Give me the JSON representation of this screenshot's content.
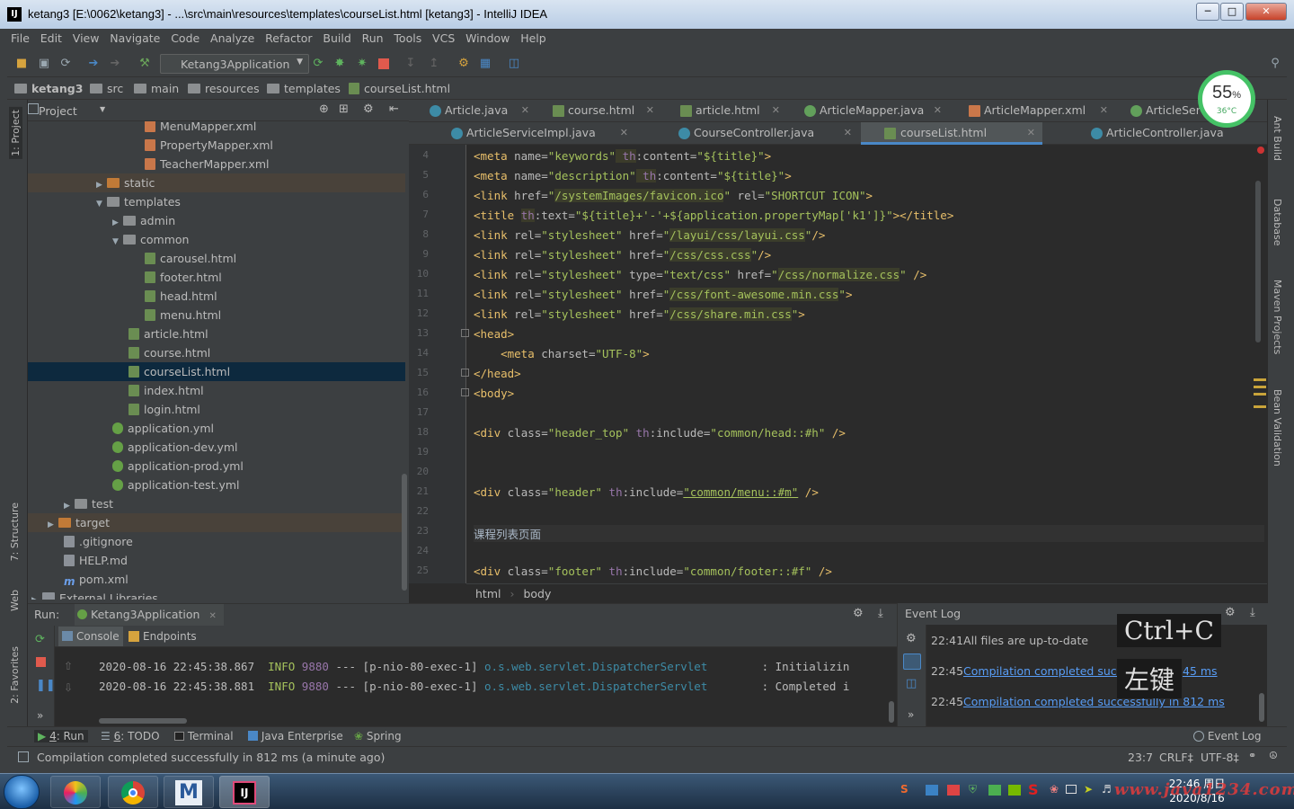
{
  "window": {
    "title": "ketang3 [E:\\0062\\ketang3] - ...\\src\\main\\resources\\templates\\courseList.html [ketang3] - IntelliJ IDEA",
    "ij_icon": "IJ"
  },
  "menu": [
    "File",
    "Edit",
    "View",
    "Navigate",
    "Code",
    "Analyze",
    "Refactor",
    "Build",
    "Run",
    "Tools",
    "VCS",
    "Window",
    "Help"
  ],
  "toolbar": {
    "run_config": "Ketang3Application"
  },
  "breadcrumbs": [
    "ketang3",
    "src",
    "main",
    "resources",
    "templates",
    "courseList.html"
  ],
  "project_panel": {
    "title": "Project",
    "tree": [
      {
        "label": "MenuMapper.xml",
        "type": "xml"
      },
      {
        "label": "PropertyMapper.xml",
        "type": "xml"
      },
      {
        "label": "TeacherMapper.xml",
        "type": "xml"
      },
      {
        "label": "static",
        "type": "folder"
      },
      {
        "label": "templates",
        "type": "folder"
      },
      {
        "label": "admin",
        "type": "folder"
      },
      {
        "label": "common",
        "type": "folder"
      },
      {
        "label": "carousel.html",
        "type": "html"
      },
      {
        "label": "footer.html",
        "type": "html"
      },
      {
        "label": "head.html",
        "type": "html"
      },
      {
        "label": "menu.html",
        "type": "html"
      },
      {
        "label": "article.html",
        "type": "html"
      },
      {
        "label": "course.html",
        "type": "html"
      },
      {
        "label": "courseList.html",
        "type": "html"
      },
      {
        "label": "index.html",
        "type": "html"
      },
      {
        "label": "login.html",
        "type": "html"
      },
      {
        "label": "application.yml",
        "type": "yml"
      },
      {
        "label": "application-dev.yml",
        "type": "yml"
      },
      {
        "label": "application-prod.yml",
        "type": "yml"
      },
      {
        "label": "application-test.yml",
        "type": "yml"
      },
      {
        "label": "test",
        "type": "folder"
      },
      {
        "label": "target",
        "type": "folder"
      },
      {
        "label": ".gitignore",
        "type": "txt"
      },
      {
        "label": "HELP.md",
        "type": "txt"
      },
      {
        "label": "pom.xml",
        "type": "m"
      },
      {
        "label": "External Libraries",
        "type": "lib"
      }
    ]
  },
  "editor_tabs_row1": [
    {
      "label": "Article.java"
    },
    {
      "label": "course.html"
    },
    {
      "label": "article.html"
    },
    {
      "label": "ArticleMapper.java"
    },
    {
      "label": "ArticleMapper.xml"
    },
    {
      "label": "ArticleServ"
    }
  ],
  "editor_tabs_row2": [
    {
      "label": "ArticleServiceImpl.java"
    },
    {
      "label": "CourseController.java"
    },
    {
      "label": "courseList.html"
    },
    {
      "label": "ArticleController.java"
    }
  ],
  "code_lines": {
    "l4": {
      "n": "4",
      "a": "<meta ",
      "b": "name=",
      "c": "\"keywords\"",
      "d": " th",
      "e": ":content=",
      "f": "\"${title}\"",
      "g": ">"
    },
    "l5": {
      "n": "5",
      "a": "<meta ",
      "b": "name=",
      "c": "\"description\"",
      "d": " th",
      "e": ":content=",
      "f": "\"${title}\"",
      "g": ">"
    },
    "l6": {
      "n": "6",
      "a": "<link ",
      "b": "href=",
      "c": "\"",
      "u": "/systemImages/favicon.ico",
      "c2": "\"",
      "e": " rel=",
      "f": "\"SHORTCUT ICON\"",
      "g": ">"
    },
    "l7": {
      "n": "7",
      "a": "<title ",
      "d": "th",
      "e": ":text=",
      "f": "\"${title}+'-'+${application.propertyMap['k1']}\"",
      "g": "></title>"
    },
    "l8": {
      "n": "8",
      "a": "<link ",
      "b": "rel=",
      "c": "\"stylesheet\"",
      "e": " href=",
      "c2": "\"",
      "u": "/layui/css/layui.css",
      "f": "\"",
      "g": "/>"
    },
    "l9": {
      "n": "9",
      "a": "<link ",
      "b": "rel=",
      "c": "\"stylesheet\"",
      "e": " href=",
      "c2": "\"",
      "u": "/css/css.css",
      "f": "\"",
      "g": "/>"
    },
    "l10": {
      "n": "10",
      "a": "<link ",
      "b": "rel=",
      "c": "\"stylesheet\"",
      "e": " type=",
      "f": "\"text/css\"",
      "h": " href=",
      "c2": "\"",
      "u": "/css/normalize.css",
      "f2": "\"",
      "g": " />"
    },
    "l11": {
      "n": "11",
      "a": "<link ",
      "b": "rel=",
      "c": "\"stylesheet\"",
      "e": " href=",
      "c2": "\"",
      "u": "/css/font-awesome.min.css",
      "f": "\"",
      "g": ">"
    },
    "l12": {
      "n": "12",
      "a": "<link ",
      "b": "rel=",
      "c": "\"stylesheet\"",
      "e": " href=",
      "c2": "\"",
      "u": "/css/share.min.css",
      "f": "\"",
      "g": ">"
    },
    "l13": {
      "n": "13",
      "a": "<head>"
    },
    "l14": {
      "n": "14",
      "a": "    <meta ",
      "b": "charset=",
      "c": "\"UTF-8\"",
      "g": ">"
    },
    "l15": {
      "n": "15",
      "a": "</head>"
    },
    "l16": {
      "n": "16",
      "a": "<body>"
    },
    "l17": {
      "n": "17"
    },
    "l18": {
      "n": "18",
      "a": "<div ",
      "b": "class=",
      "c": "\"header_top\"",
      "d": " th",
      "e": ":include=",
      "f": "\"common/head::#h\"",
      "g": " />"
    },
    "l19": {
      "n": "19"
    },
    "l20": {
      "n": "20"
    },
    "l21": {
      "n": "21",
      "a": "<div ",
      "b": "class=",
      "c": "\"header\"",
      "d": " th",
      "e": ":include=",
      "f": "\"common/menu::#m\"",
      "g": " />"
    },
    "l22": {
      "n": "22"
    },
    "l23": {
      "n": "23",
      "t": "课程列表页面"
    },
    "l24": {
      "n": "24"
    },
    "l25": {
      "n": "25",
      "a": "<div ",
      "b": "class=",
      "c": "\"footer\"",
      "d": " th",
      "e": ":include=",
      "f": "\"common/footer::#f\"",
      "g": " />"
    }
  },
  "editor_breadcrumb": [
    "html",
    "body"
  ],
  "run_panel": {
    "label": "Run:",
    "config": "Ketang3Application",
    "tabs": [
      "Console",
      "Endpoints"
    ],
    "log": [
      {
        "ts": "2020-08-16 22:45:38.867",
        "level": "INFO",
        "pid": "9880",
        "sep": "---",
        "thread": "[p-nio-80-exec-1]",
        "cls": "o.s.web.servlet.DispatcherServlet",
        "msg": ": Initializin"
      },
      {
        "ts": "2020-08-16 22:45:38.881",
        "level": "INFO",
        "pid": "9880",
        "sep": "---",
        "thread": "[p-nio-80-exec-1]",
        "cls": "o.s.web.servlet.DispatcherServlet",
        "msg": ": Completed i"
      }
    ]
  },
  "event_log": {
    "title": "Event Log",
    "entries": [
      {
        "time": "22:41",
        "text": "All files are up-to-date",
        "link": ""
      },
      {
        "time": "22:45",
        "text": "",
        "link": "Compilation completed succes",
        "tail": "45 ms"
      },
      {
        "time": "22:45",
        "text": "",
        "link": "Compilation completed successfully in 812 ms"
      }
    ],
    "overlay1": "Ctrl+C",
    "overlay2": "左键"
  },
  "bottom_tabs": [
    {
      "num": "4",
      "label": ": Run"
    },
    {
      "num": "6",
      "label": ": TODO"
    },
    {
      "num": "",
      "label": "Terminal"
    },
    {
      "num": "",
      "label": "Java Enterprise"
    },
    {
      "num": "",
      "label": "Spring"
    }
  ],
  "event_log_tab": "Event Log",
  "status": {
    "message": "Compilation completed successfully in 812 ms (a minute ago)",
    "position": "23:7",
    "line_sep": "CRLF‡",
    "encoding": "UTF-8‡"
  },
  "left_vtabs": [
    "1: Project",
    "7: Structure",
    "Web",
    "2: Favorites"
  ],
  "right_vtabs": [
    "Ant Build",
    "Database",
    "Maven Projects",
    "Bean Validation"
  ],
  "gauge": {
    "percent": "55",
    "unit": "%",
    "temp": "36°C"
  },
  "taskbar": {
    "clock_time": "22:46 周日",
    "clock_date": "2020/8/16",
    "watermark": "www.java1234.com"
  }
}
